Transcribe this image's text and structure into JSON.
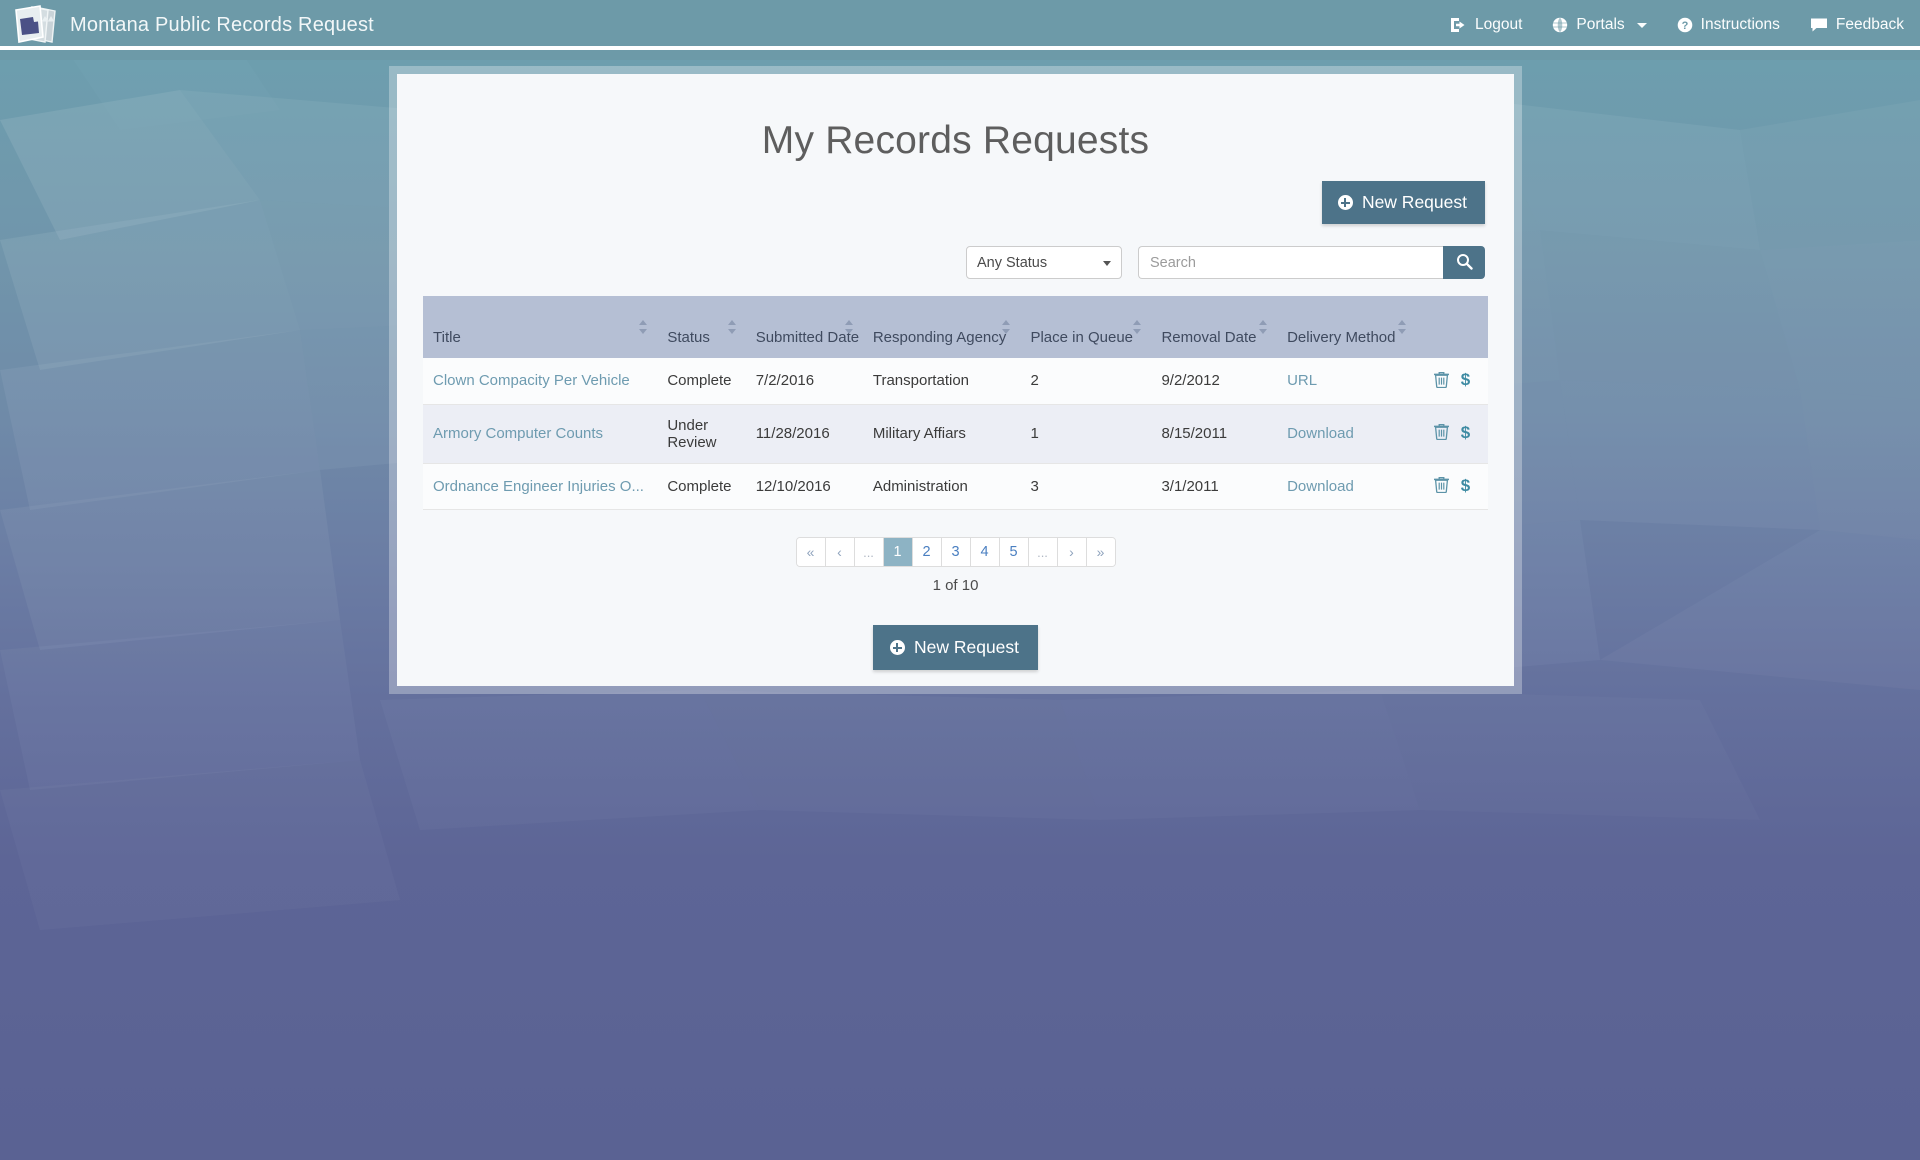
{
  "navbar": {
    "brand": "Montana Public Records Request",
    "brand_logo_icon": "documents-stack-montana-icon",
    "items": [
      {
        "label": "Logout",
        "icon": "logout-icon"
      },
      {
        "label": "Portals",
        "icon": "globe-icon",
        "caret": true
      },
      {
        "label": "Instructions",
        "icon": "question-circle-icon"
      },
      {
        "label": "Feedback",
        "icon": "comment-icon"
      }
    ]
  },
  "page": {
    "title": "My Records Requests"
  },
  "actions": {
    "new_request_label": "New Request",
    "new_request_icon": "plus-circle-icon"
  },
  "filters": {
    "status_selected": "Any Status",
    "status_options": [
      "Any Status"
    ],
    "search_value": "",
    "search_placeholder": "Search",
    "search_button_icon": "search-icon"
  },
  "table": {
    "columns": [
      {
        "label": "Title",
        "sortable": true
      },
      {
        "label": "Status",
        "sortable": true
      },
      {
        "label": "Submitted Date",
        "sortable": true
      },
      {
        "label": "Responding Agency",
        "sortable": true
      },
      {
        "label": "Place in Queue",
        "sortable": true
      },
      {
        "label": "Removal Date",
        "sortable": true
      },
      {
        "label": "Delivery Method",
        "sortable": true
      },
      {
        "label": "",
        "sortable": false
      }
    ],
    "rows": [
      {
        "title": "Clown Compacity Per Vehicle",
        "status": "Complete",
        "submitted_date": "7/2/2016",
        "responding_agency": "Transportation",
        "place_in_queue": "2",
        "removal_date": "9/2/2012",
        "delivery_method": "URL",
        "delete_icon": "trash-icon",
        "invoice_icon": "dollar-icon"
      },
      {
        "title": "Armory Computer Counts",
        "status": "Under Review",
        "submitted_date": "11/28/2016",
        "responding_agency": "Military Affiars",
        "place_in_queue": "1",
        "removal_date": "8/15/2011",
        "delivery_method": "Download",
        "delete_icon": "trash-icon",
        "invoice_icon": "dollar-icon"
      },
      {
        "title": "Ordnance Engineer Injuries O...",
        "status": "Complete",
        "submitted_date": "12/10/2016",
        "responding_agency": "Administration",
        "place_in_queue": "3",
        "removal_date": "3/1/2011",
        "delivery_method": "Download",
        "delete_icon": "trash-icon",
        "invoice_icon": "dollar-icon"
      }
    ]
  },
  "pagination": {
    "items": [
      {
        "label": "«",
        "kind": "arrow",
        "name": "first"
      },
      {
        "label": "‹",
        "kind": "arrow",
        "name": "prev"
      },
      {
        "label": "...",
        "kind": "ellip",
        "name": "ellipsis-left"
      },
      {
        "label": "1",
        "kind": "active",
        "name": "page-1"
      },
      {
        "label": "2",
        "kind": "page",
        "name": "page-2"
      },
      {
        "label": "3",
        "kind": "page",
        "name": "page-3"
      },
      {
        "label": "4",
        "kind": "page",
        "name": "page-4"
      },
      {
        "label": "5",
        "kind": "page",
        "name": "page-5"
      },
      {
        "label": "...",
        "kind": "ellip",
        "name": "ellipsis-right"
      },
      {
        "label": "›",
        "kind": "arrow",
        "name": "next"
      },
      {
        "label": "»",
        "kind": "arrow",
        "name": "last"
      }
    ],
    "summary": "1 of 10",
    "current_page": 1,
    "total_pages": 10
  },
  "colors": {
    "navbar": "#6d9aa8",
    "accent_button": "#4d7389",
    "table_header": "#b5bfd4",
    "link": "#6e9bb0",
    "active_page": "#8db3c4",
    "panel_bg": "#f6f8fa"
  }
}
